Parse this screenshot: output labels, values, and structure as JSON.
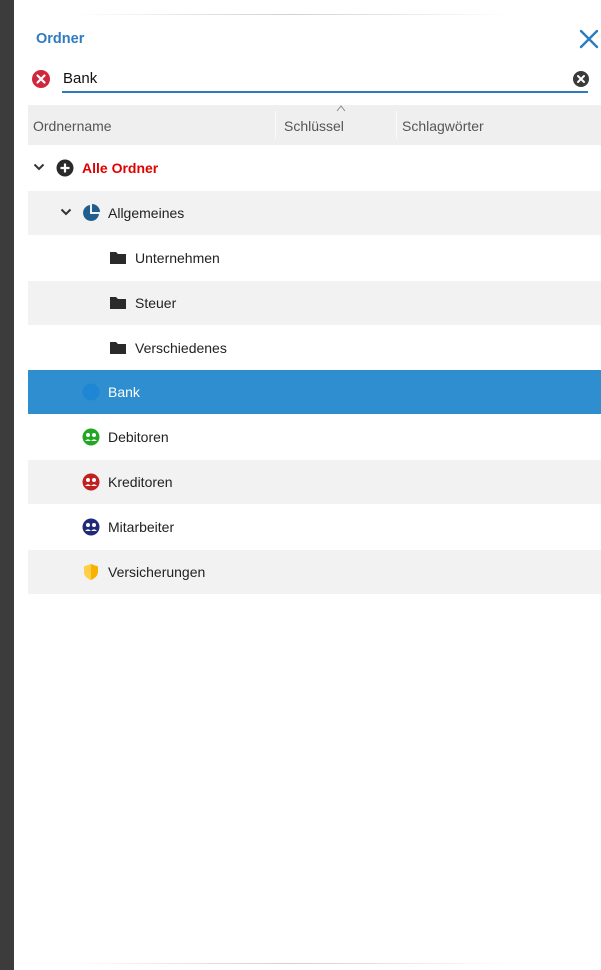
{
  "panel": {
    "title": "Ordner"
  },
  "search": {
    "value": "Bank"
  },
  "columns": [
    "Ordnername",
    "Schlüssel",
    "Schlagwörter"
  ],
  "tree": [
    {
      "label": "Alle Ordner",
      "icon": "plus-circle-icon"
    },
    {
      "label": "Allgemeines",
      "icon": "pie-chart-icon"
    },
    {
      "label": "Unternehmen",
      "icon": "folder-icon"
    },
    {
      "label": "Steuer",
      "icon": "folder-icon"
    },
    {
      "label": "Verschiedenes",
      "icon": "folder-icon"
    },
    {
      "label": "Bank",
      "icon": "bank-icon"
    },
    {
      "label": "Debitoren",
      "icon": "group-icon"
    },
    {
      "label": "Kreditoren",
      "icon": "group-icon"
    },
    {
      "label": "Mitarbeiter",
      "icon": "group-icon"
    },
    {
      "label": "Versicherungen",
      "icon": "shield-icon"
    }
  ],
  "colors": {
    "accent": "#2e7bbf",
    "selection": "#2f8ecf",
    "root_label": "#e00000",
    "error": "#d0273d",
    "debitoren": "#22a722",
    "kreditoren": "#c0201e",
    "mitarbeiter": "#1f2a7a",
    "versicherungen": "#f5b300",
    "allgemeines": "#1f5f8f"
  }
}
